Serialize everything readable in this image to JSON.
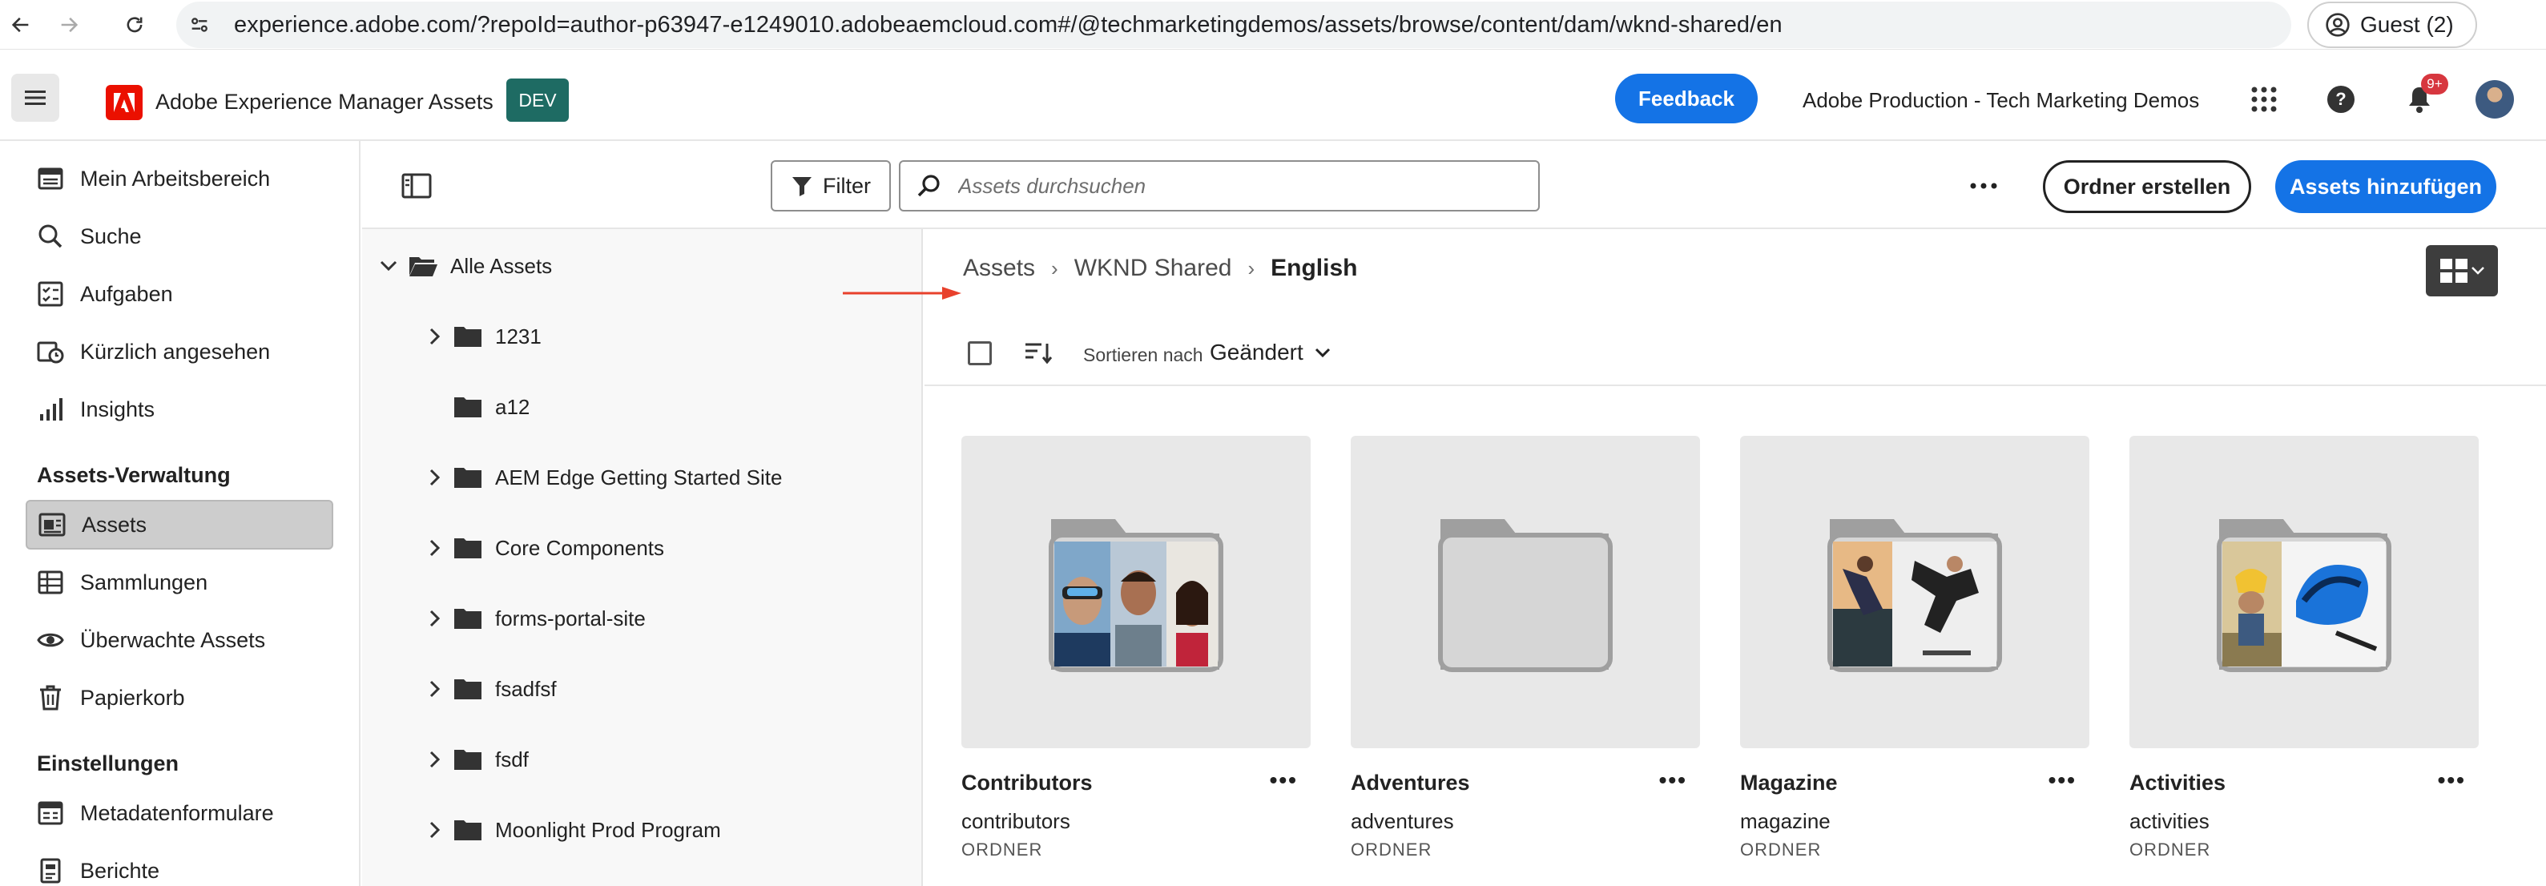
{
  "browser": {
    "url": "experience.adobe.com/?repoId=author-p63947-e1249010.adobeaemcloud.com#/@techmarketingdemos/assets/browse/content/dam/wknd-shared/en",
    "profile_label": "Guest (2)"
  },
  "header": {
    "app_title": "Adobe Experience Manager Assets",
    "env_badge": "DEV",
    "feedback_label": "Feedback",
    "org_name": "Adobe Production - Tech Marketing Demos",
    "notification_count": "9+"
  },
  "sidebar": {
    "items": [
      {
        "label": "Mein Arbeitsbereich",
        "icon": "workspace-icon"
      },
      {
        "label": "Suche",
        "icon": "search-icon"
      },
      {
        "label": "Aufgaben",
        "icon": "tasks-icon"
      },
      {
        "label": "Kürzlich angesehen",
        "icon": "recent-icon"
      },
      {
        "label": "Insights",
        "icon": "chart-icon"
      }
    ],
    "section_assets": "Assets-Verwaltung",
    "assets_items": [
      {
        "label": "Assets",
        "icon": "assets-icon",
        "active": true
      },
      {
        "label": "Sammlungen",
        "icon": "collections-icon"
      },
      {
        "label": "Überwachte Assets",
        "icon": "eye-icon"
      },
      {
        "label": "Papierkorb",
        "icon": "trash-icon"
      }
    ],
    "section_settings": "Einstellungen",
    "settings_items": [
      {
        "label": "Metadatenformulare",
        "icon": "form-icon"
      },
      {
        "label": "Berichte",
        "icon": "reports-icon"
      }
    ]
  },
  "toolbar": {
    "filter_label": "Filter",
    "search_placeholder": "Assets durchsuchen",
    "create_folder_label": "Ordner erstellen",
    "add_assets_label": "Assets hinzufügen"
  },
  "tree": {
    "root": "Alle Assets",
    "folders": [
      {
        "label": "1231",
        "expandable": true
      },
      {
        "label": "a12",
        "expandable": false
      },
      {
        "label": "AEM Edge Getting Started Site",
        "expandable": true
      },
      {
        "label": "Core Components",
        "expandable": true
      },
      {
        "label": "forms-portal-site",
        "expandable": true
      },
      {
        "label": "fsadfsf",
        "expandable": true
      },
      {
        "label": "fsdf",
        "expandable": true
      },
      {
        "label": "Moonlight Prod Program",
        "expandable": true
      }
    ]
  },
  "breadcrumb": [
    "Assets",
    "WKND Shared",
    "English"
  ],
  "sort": {
    "label": "Sortieren nach",
    "value": "Geändert"
  },
  "cards": [
    {
      "title": "Contributors",
      "subtitle": "contributors",
      "type": "ORDNER",
      "preview": "people"
    },
    {
      "title": "Adventures",
      "subtitle": "adventures",
      "type": "ORDNER",
      "preview": "empty"
    },
    {
      "title": "Magazine",
      "subtitle": "magazine",
      "type": "ORDNER",
      "preview": "skate"
    },
    {
      "title": "Activities",
      "subtitle": "activities",
      "type": "ORDNER",
      "preview": "bike"
    }
  ],
  "colors": {
    "accent": "#1473e6",
    "env_badge": "#1e6b63",
    "brand_red": "#eb1000",
    "arrow": "#e8412c"
  }
}
